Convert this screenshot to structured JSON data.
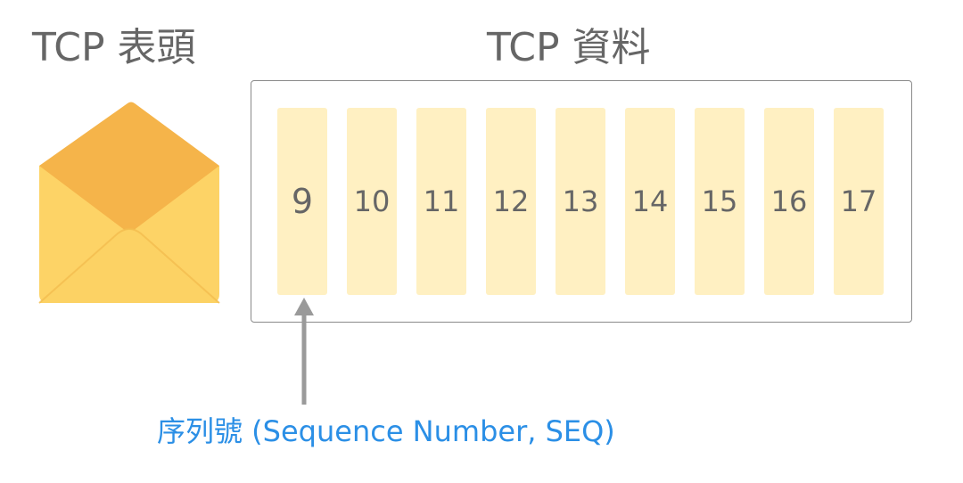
{
  "header": {
    "title": "TCP 表頭"
  },
  "data": {
    "title": "TCP 資料",
    "segments": [
      "9",
      "10",
      "11",
      "12",
      "13",
      "14",
      "15",
      "16",
      "17"
    ]
  },
  "annotation": {
    "label": "序列號 (Sequence Number, SEQ)"
  },
  "colors": {
    "envelope_flap": "#f5b44a",
    "envelope_body": "#fdd366",
    "segment_fill": "#fff0c2",
    "label_blue": "#2b8fe6",
    "text_gray": "#666666",
    "arrow_gray": "#9a9a9a"
  },
  "icons": {
    "envelope": "envelope-open-icon",
    "pointer": "arrow-up-icon"
  }
}
